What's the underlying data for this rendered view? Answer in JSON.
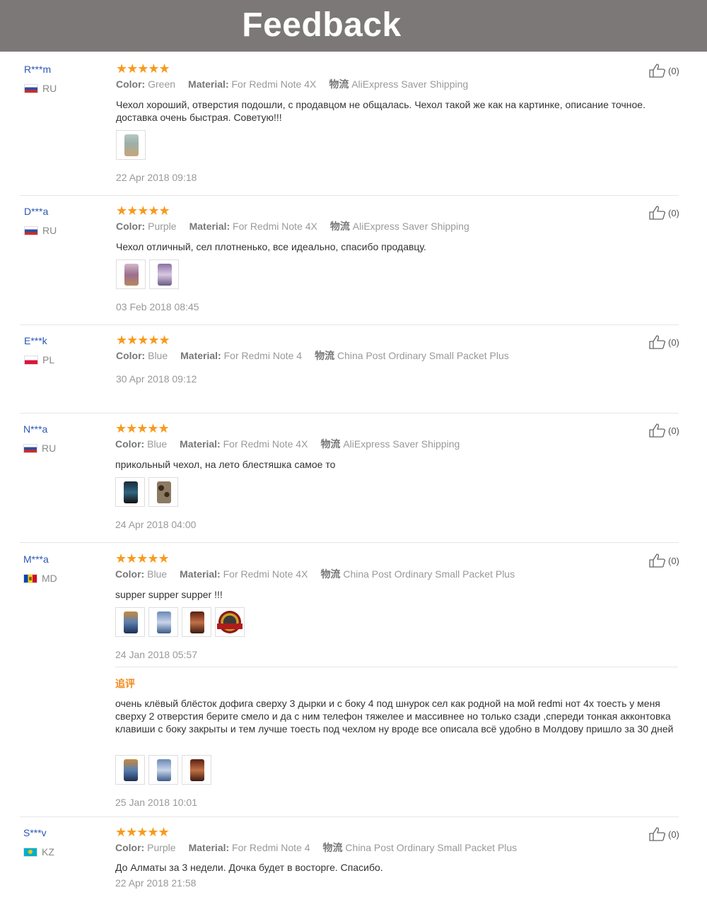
{
  "header": {
    "title": "Feedback"
  },
  "labels": {
    "color": "Color:",
    "material": "Material:",
    "ship": "物流",
    "followup": "追评"
  },
  "stars": "★★★★★",
  "reviews": [
    {
      "user": "R***m",
      "country": "RU",
      "rating": 5,
      "color": "Green",
      "material": "For Redmi Note 4X",
      "shipping": "AliExpress Saver Shipping",
      "text": "Чехол хороший, отверстия подошли, с продавцом не общалась. Чехол такой же как на картинке, описание точное. доставка очень быстрая. Советую!!!",
      "date": "22 Apr 2018 09:18",
      "likes": "(0)"
    },
    {
      "user": "D***a",
      "country": "RU",
      "rating": 5,
      "color": "Purple",
      "material": "For Redmi Note 4X",
      "shipping": "AliExpress Saver Shipping",
      "text": "Чехол отличный, сел плотненько, все идеально, спасибо продавцу.",
      "date": "03 Feb 2018 08:45",
      "likes": "(0)"
    },
    {
      "user": "E***k",
      "country": "PL",
      "rating": 5,
      "color": "Blue",
      "material": "For Redmi Note 4",
      "shipping": "China Post Ordinary Small Packet Plus",
      "text": "",
      "date": "30 Apr 2018 09:12",
      "likes": "(0)"
    },
    {
      "user": "N***a",
      "country": "RU",
      "rating": 5,
      "color": "Blue",
      "material": "For Redmi Note 4X",
      "shipping": "AliExpress Saver Shipping",
      "text": "прикольный чехол, на лето блестяшка самое то",
      "date": "24 Apr 2018 04:00",
      "likes": "(0)"
    },
    {
      "user": "M***a",
      "country": "MD",
      "rating": 5,
      "color": "Blue",
      "material": "For Redmi Note 4X",
      "shipping": "China Post Ordinary Small Packet Plus",
      "text": "supper supper supper !!!",
      "date": "24 Jan 2018 05:57",
      "likes": "(0)",
      "followup_text": "очень клёвый блёсток дофига сверху 3 дырки и с боку 4 под шнурок сел как родной на мой redmi нот 4x тоесть у меня сверху 2 отверстия берите смело и да с ним телефон тяжелее и массивнее но только сзади ,спереди тонкая акконтовка клавиши с боку закрыты и тем лучше тоесть под чехлом ну вроде все описала всё удобно в Молдову пришло за 30 дней",
      "followup_date": "25 Jan 2018 10:01"
    },
    {
      "user": "S***v",
      "country": "KZ",
      "rating": 5,
      "color": "Purple",
      "material": "For Redmi Note 4",
      "shipping": "China Post Ordinary Small Packet Plus",
      "text": "До Алматы за 3 недели. Дочка будет в восторге. Спасибо.",
      "date": "22 Apr 2018 21:58",
      "likes": "(0)"
    }
  ]
}
